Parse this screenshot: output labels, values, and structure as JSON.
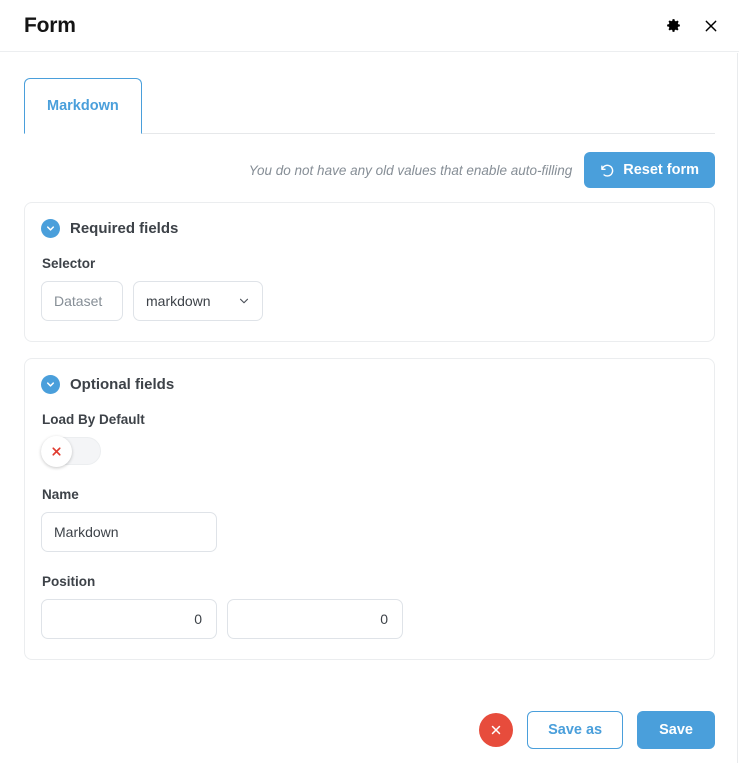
{
  "window": {
    "title": "Form",
    "settings_icon": "gear-icon",
    "close_icon": "close-icon"
  },
  "tabs": [
    {
      "label": "Markdown",
      "active": true
    }
  ],
  "reset": {
    "note": "You do not have any old values that enable auto-filling",
    "button_label": "Reset form",
    "button_icon": "rotate-ccw-icon"
  },
  "sections": [
    {
      "title": "Required fields",
      "collapse_icon": "chevron-down-circle-icon",
      "fields": [
        {
          "label": "Selector",
          "dataset_placeholder": "Dataset",
          "dataset_value": "",
          "select_value": "markdown",
          "select_options": [
            "markdown"
          ]
        }
      ]
    },
    {
      "title": "Optional fields",
      "collapse_icon": "chevron-down-circle-icon",
      "fields": [
        {
          "label": "Load By Default",
          "toggle_state": "off",
          "toggle_icon": "cross-icon"
        },
        {
          "label": "Name",
          "value": "Markdown"
        },
        {
          "label": "Position",
          "value_x": "0",
          "value_y": "0"
        }
      ]
    }
  ],
  "footer": {
    "cancel_icon": "close-icon",
    "save_as_label": "Save as",
    "save_label": "Save"
  },
  "colors": {
    "accent_blue": "#4a9fdb",
    "danger_red": "#e74c3c",
    "text_dark": "#3d4248",
    "text_muted": "#868e96",
    "border": "#dfe3e8"
  }
}
